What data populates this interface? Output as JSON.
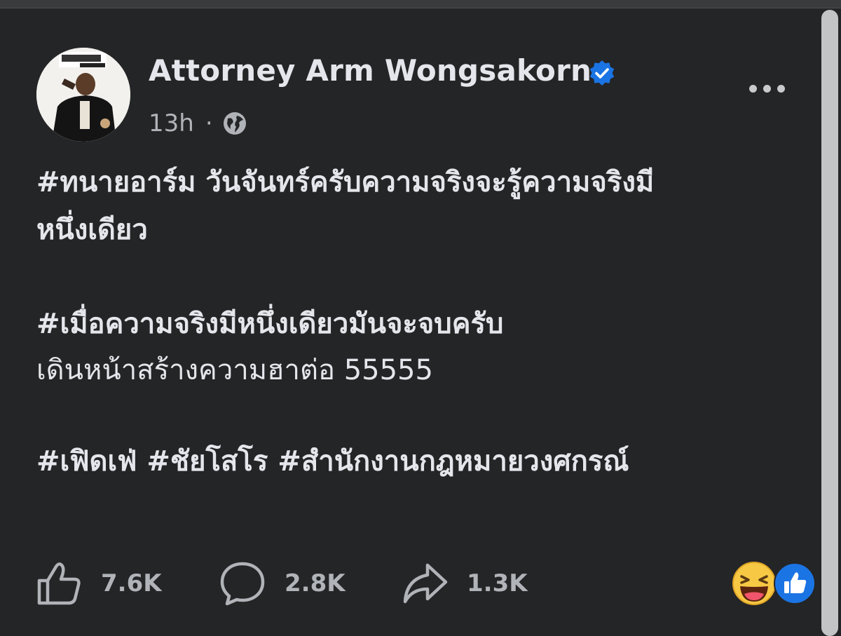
{
  "post": {
    "author": "Attorney Arm Wongsakorn",
    "timestamp": "13h",
    "separator": "·",
    "privacy_icon": "globe-icon",
    "verified_icon": "verified-badge-icon",
    "more_icon": "more-options-icon",
    "lines": [
      "#ทนายอาร์ม วันจันทร์ครับความจริงจะรู้ความจริงมี",
      "หนึ่งเดียว",
      "#เมื่อความจริงมีหนึ่งเดียวมันจะจบครับ",
      "เดินหน้าสร้างความฮาต่อ 55555",
      "#เฟิดเฟ่ #ชัยโสโร #สำนักงานกฎหมายวงศกรณ์"
    ]
  },
  "actions": {
    "like": {
      "icon": "thumbs-up-icon",
      "count": "7.6K"
    },
    "comment": {
      "icon": "comment-icon",
      "count": "2.8K"
    },
    "share": {
      "icon": "share-icon",
      "count": "1.3K"
    }
  },
  "reactions": [
    "haha-reaction-icon",
    "like-reaction-icon"
  ],
  "colors": {
    "background": "#242526",
    "primary_text": "#e4e6eb",
    "secondary_text": "#b0b3b8",
    "verified_blue": "#1b74e4"
  }
}
